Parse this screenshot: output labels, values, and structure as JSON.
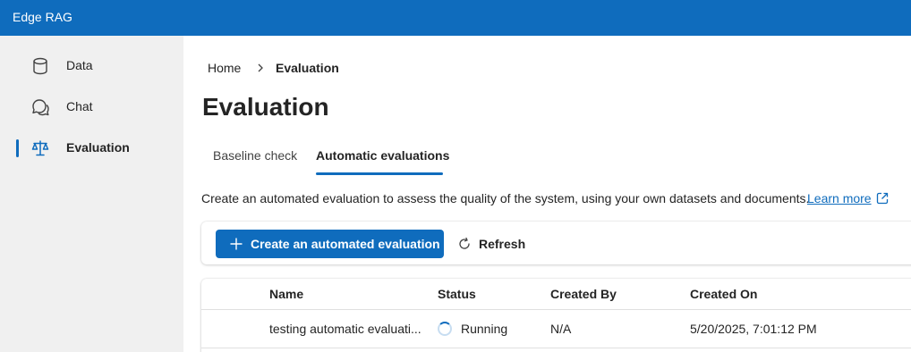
{
  "app": {
    "title": "Edge RAG"
  },
  "sidebar": {
    "items": [
      {
        "label": "Data",
        "icon": "database-icon"
      },
      {
        "label": "Chat",
        "icon": "chat-icon"
      },
      {
        "label": "Evaluation",
        "icon": "scales-icon",
        "active": true
      }
    ]
  },
  "breadcrumb": {
    "home": "Home",
    "current": "Evaluation"
  },
  "page": {
    "title": "Evaluation"
  },
  "tabs": [
    {
      "label": "Baseline check"
    },
    {
      "label": "Automatic evaluations",
      "active": true
    }
  ],
  "description": {
    "text": "Create an automated evaluation to assess the quality of the system, using your own datasets and documents.",
    "link": "Learn more"
  },
  "toolbar": {
    "create_label": "Create an automated evaluation",
    "refresh_label": "Refresh"
  },
  "table": {
    "columns": [
      "Name",
      "Status",
      "Created By",
      "Created On"
    ],
    "rows": [
      {
        "name": "testing automatic evaluati...",
        "status": "Running",
        "created_by": "N/A",
        "created_on": "5/20/2025, 7:01:12 PM"
      }
    ]
  },
  "colors": {
    "accent": "#0f6cbd",
    "sidebar_bg": "#f0f0f0"
  }
}
